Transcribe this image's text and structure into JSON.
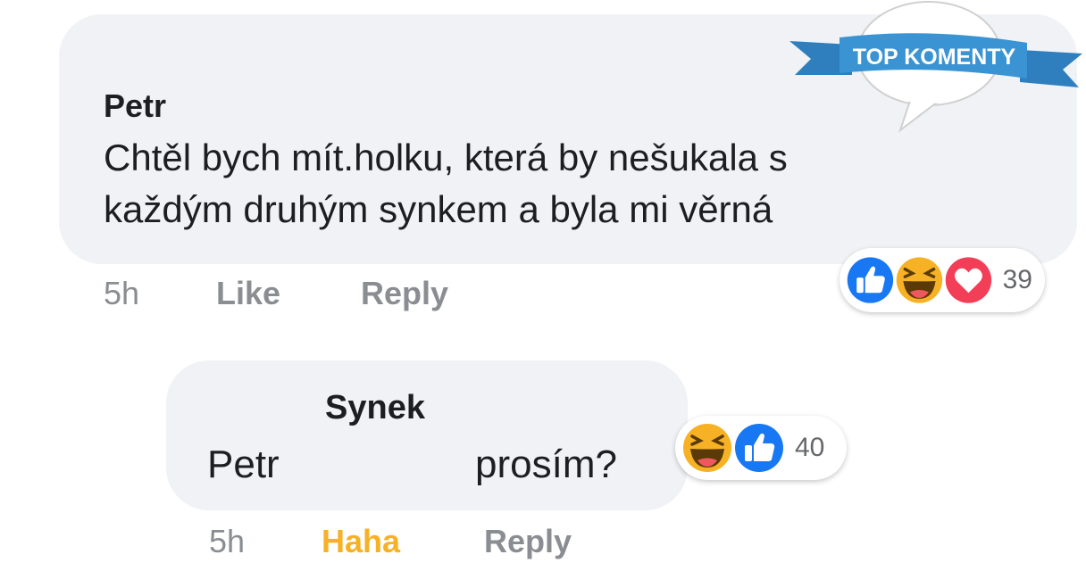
{
  "badge": {
    "label": "TOP KOMENTY"
  },
  "comment1": {
    "author": "Petr",
    "text": "Chtěl bych mít.holku, která by nešukala s\nkaždým druhým synkem a byla mi věrná",
    "time": "5h",
    "like_label": "Like",
    "reply_label": "Reply",
    "reactions": [
      "like-icon",
      "haha-icon",
      "love-icon"
    ],
    "reaction_count": "39"
  },
  "comment2": {
    "author": "Synek",
    "text_start": "Petr",
    "text_end": "prosím?",
    "time": "5h",
    "reaction_label": "Haha",
    "reply_label": "Reply",
    "reactions": [
      "haha-icon",
      "like-icon"
    ],
    "reaction_count": "40"
  },
  "colors": {
    "bubble": "#f0f2f5",
    "like_blue": "#1877f2",
    "haha_yellow": "#f7b125",
    "love_red": "#f33e58",
    "badge_blue": "#3a93d2",
    "action_gray": "#8a8d91"
  }
}
